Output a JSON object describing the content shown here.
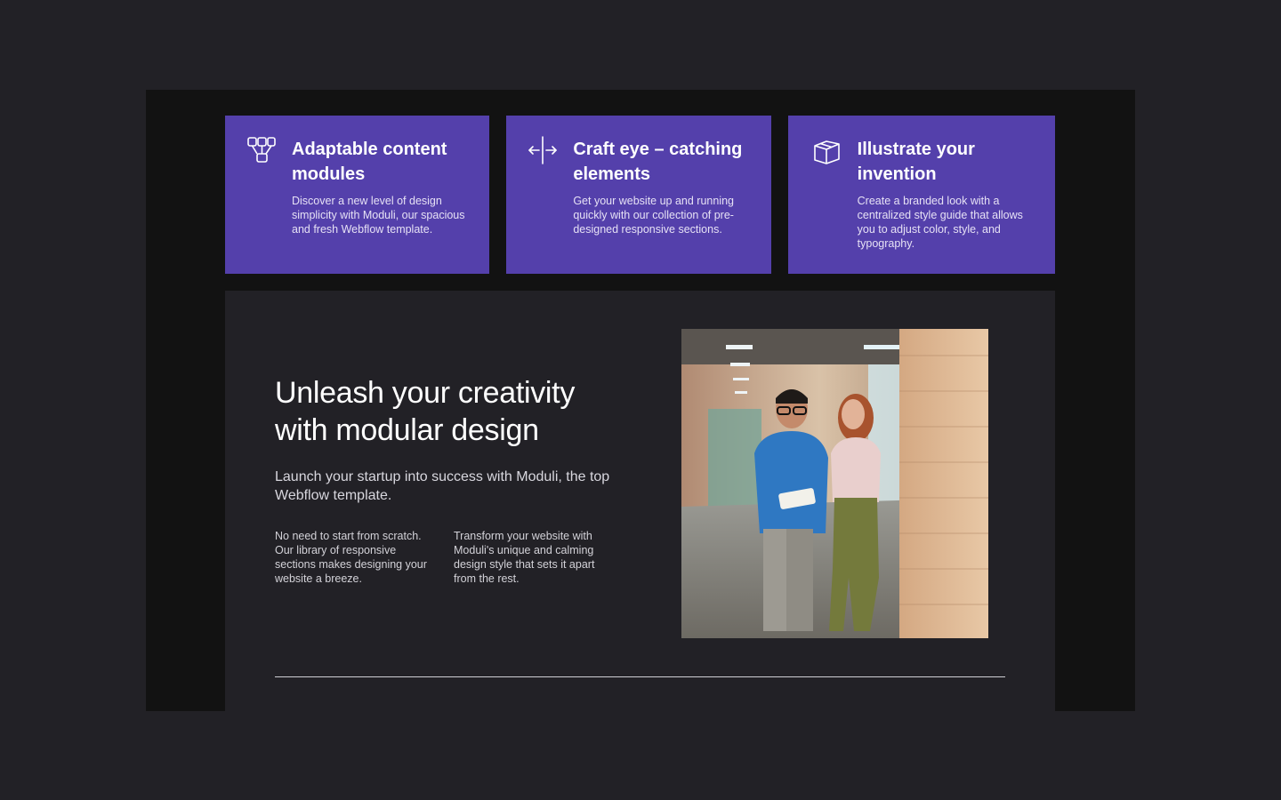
{
  "cards": [
    {
      "icon": "modules-icon",
      "title": "Adaptable content modules",
      "description": "Discover a new level of design simplicity with Moduli, our spacious and fresh Webflow template."
    },
    {
      "icon": "arrows-horizontal-icon",
      "title": "Craft eye – catching elements",
      "description": "Get your website up and running quickly with our collection of pre-designed responsive sections."
    },
    {
      "icon": "cube-icon",
      "title": "Illustrate your invention",
      "description": "Create a branded look with a centralized style guide that allows you to adjust color, style, and typography."
    }
  ],
  "feature": {
    "headline": "Unleash your creativity with modular design",
    "lead": "Launch your startup into success with Moduli, the top Webflow template.",
    "col1": "No need to start from scratch. Our library of responsive sections makes designing your website a breeze.",
    "col2": "Transform your website with Moduli's unique and calming design style that sets it apart from the rest.",
    "image": "office-hallway-two-people-photo"
  },
  "colors": {
    "page_background": "#222126",
    "frame_background": "#121212",
    "card_background": "#5440ab",
    "text_primary": "#ffffff"
  }
}
